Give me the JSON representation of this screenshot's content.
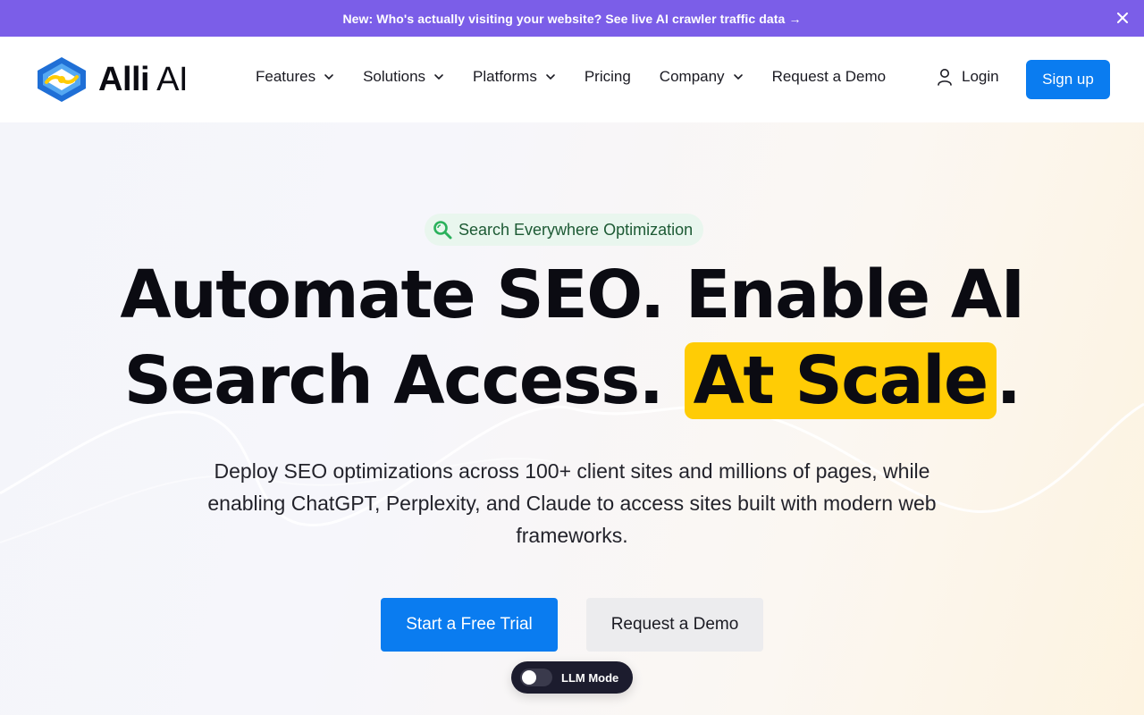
{
  "announcement": {
    "text": "New: Who's actually visiting your website? See live AI crawler traffic data →",
    "close_icon": "close-icon"
  },
  "header": {
    "logo_bold": "Alli",
    "logo_light": "AI",
    "nav": [
      {
        "label": "Features",
        "has_dropdown": true
      },
      {
        "label": "Solutions",
        "has_dropdown": true
      },
      {
        "label": "Platforms",
        "has_dropdown": true
      },
      {
        "label": "Pricing",
        "has_dropdown": false
      },
      {
        "label": "Company",
        "has_dropdown": true
      },
      {
        "label": "Request a Demo",
        "has_dropdown": false
      }
    ],
    "login_label": "Login",
    "signup_label": "Sign up"
  },
  "hero": {
    "badge_text": "Search Everywhere Optimization",
    "headline_line1": "Automate SEO. Enable AI",
    "headline_line2_prefix": "Search Access. ",
    "headline_highlight": "At Scale",
    "headline_suffix": ".",
    "subtext": "Deploy SEO optimizations across 100+ client sites and millions of pages, while enabling ChatGPT, Perplexity, and Claude to access sites built with modern web frameworks.",
    "primary_cta": "Start a Free Trial",
    "secondary_cta": "Request a Demo",
    "llm_mode_label": "LLM Mode",
    "llm_mode_on": false
  },
  "colors": {
    "announcement_bg": "#7b5ee8",
    "brand_blue": "#0a7cf0",
    "highlight_yellow": "#ffcc05",
    "badge_bg": "#e9f6ee",
    "badge_text": "#1d5a34"
  }
}
